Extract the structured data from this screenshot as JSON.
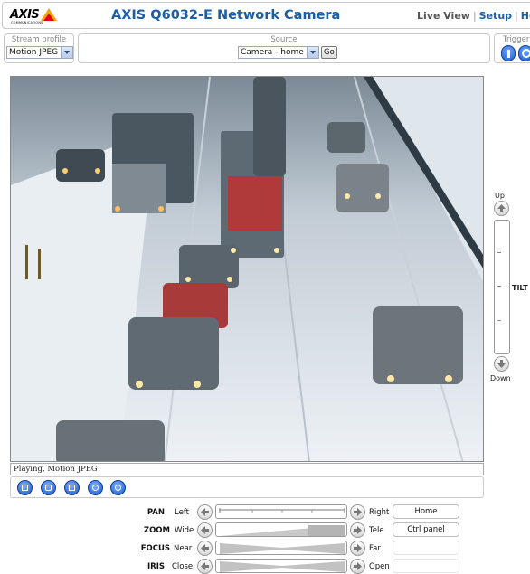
{
  "header": {
    "logo_text": "AXIS",
    "logo_sub": "COMMUNICATIONS",
    "title": "AXIS Q6032-E Network Camera",
    "nav": {
      "live_view": "Live View",
      "setup": "Setup",
      "help": "Help",
      "separator": "|"
    }
  },
  "toolbar": {
    "stream_profile": {
      "label": "Stream profile",
      "value": "Motion JPEG"
    },
    "source": {
      "label": "Source",
      "value": "Camera - home",
      "go": "Go"
    },
    "triggers": {
      "label": "Triggers"
    }
  },
  "status": "Playing, Motion JPEG",
  "tilt": {
    "up": "Up",
    "down": "Down",
    "label": "TILT"
  },
  "ptz": {
    "pan": {
      "label": "PAN",
      "left": "Left",
      "right": "Right"
    },
    "zoom": {
      "label": "ZOOM",
      "left": "Wide",
      "right": "Tele"
    },
    "focus": {
      "label": "FOCUS",
      "left": "Near",
      "right": "Far"
    },
    "iris": {
      "label": "IRIS",
      "left": "Close",
      "right": "Open"
    }
  },
  "buttons": {
    "home": "Home",
    "ctrl_panel": "Ctrl panel"
  },
  "colors": {
    "brand_blue": "#1a5ea8",
    "logo_yellow": "#f5a800",
    "logo_red": "#e2001a",
    "button_blue": "#1a56c9"
  },
  "icons": [
    "left-arrow-icon",
    "right-arrow-icon",
    "up-arrow-icon",
    "down-arrow-icon",
    "snapshot-icon",
    "stop-icon"
  ]
}
